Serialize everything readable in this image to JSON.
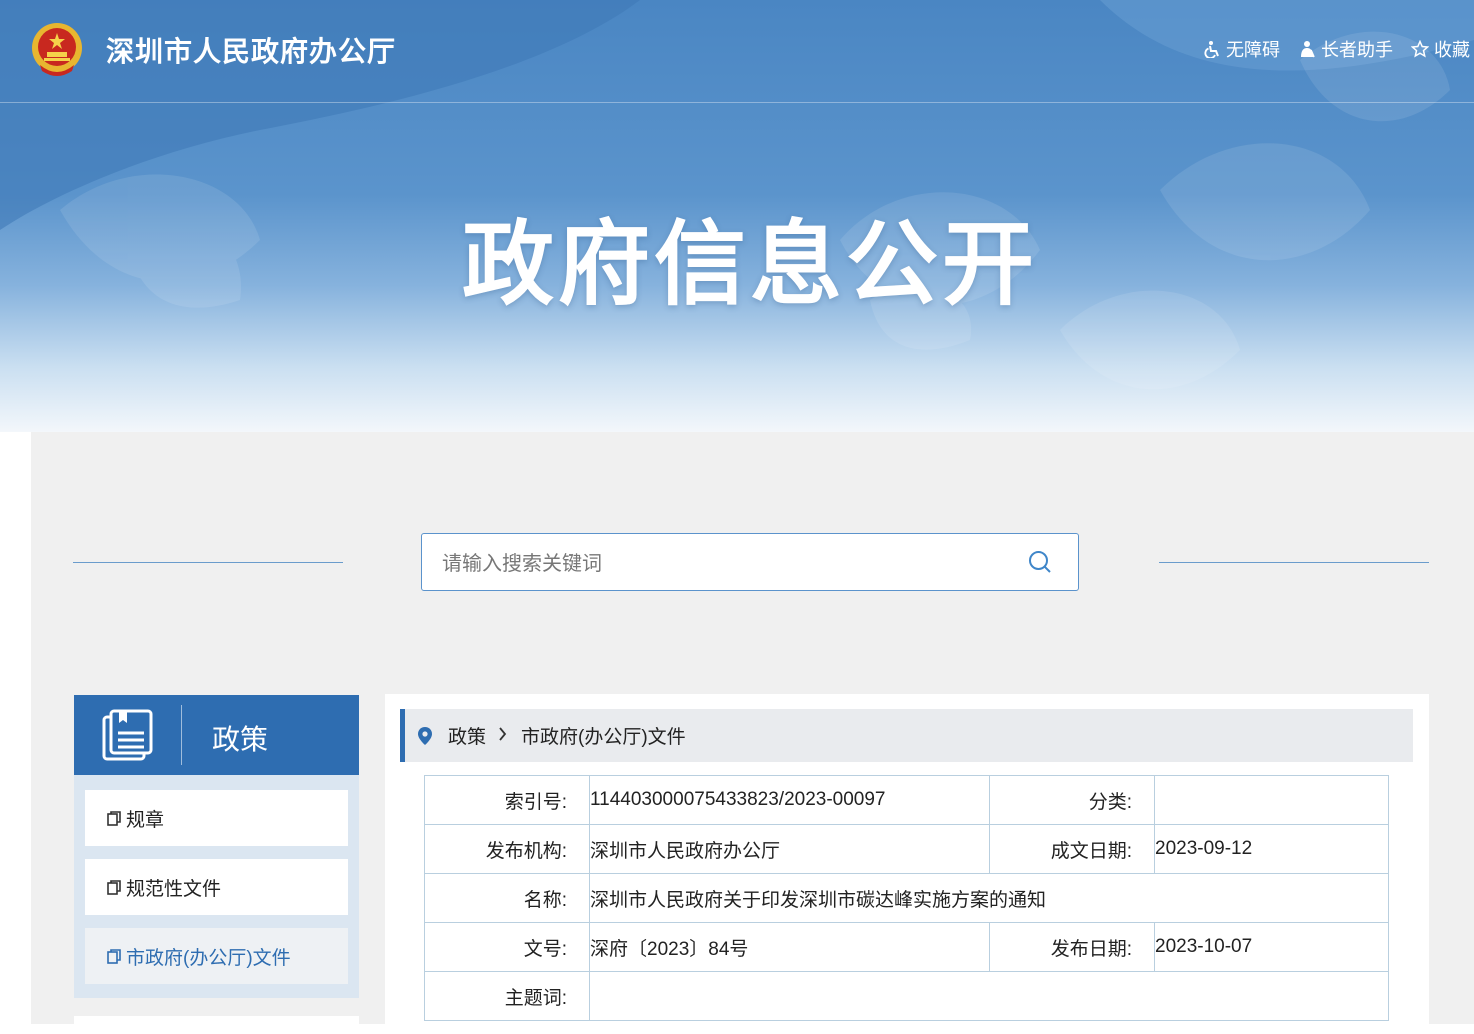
{
  "header": {
    "site_title": "深圳市人民政府办公厅",
    "tools": [
      {
        "label": "无障碍",
        "icon": "accessibility-icon"
      },
      {
        "label": "长者助手",
        "icon": "elder-helper-icon"
      },
      {
        "label": "收藏",
        "icon": "star-icon"
      }
    ]
  },
  "hero": {
    "title": "政府信息公开"
  },
  "search": {
    "placeholder": "请输入搜索关键词"
  },
  "sidebar": {
    "heading": "政策",
    "items": [
      {
        "label": "规章"
      },
      {
        "label": "规范性文件"
      },
      {
        "label": "市政府(办公厅)文件",
        "active": true
      }
    ]
  },
  "breadcrumb": [
    "政策",
    "市政府(办公厅)文件"
  ],
  "meta": {
    "index_label": "索引号:",
    "index_value": "11440300007543382 3/2023-00097",
    "category_label": "分类:",
    "category_value": "",
    "publisher_label": "发布机构:",
    "publisher_value": "深圳市人民政府办公厅",
    "written_date_label": "成文日期:",
    "written_date_value": "2023-09-12",
    "name_label": "名称:",
    "name_value": "深圳市人民政府关于印发深圳市碳达峰实施方案的通知",
    "doc_no_label": "文号:",
    "doc_no_value": "深府〔2023〕84号",
    "publish_date_label": "发布日期:",
    "publish_date_value": "2023-10-07",
    "subject_label": "主题词:",
    "subject_value": ""
  },
  "colors": {
    "brand_blue": "#2e6db1",
    "banner_blue": "#4a86c3",
    "panel_gray": "#f0f0f0"
  }
}
